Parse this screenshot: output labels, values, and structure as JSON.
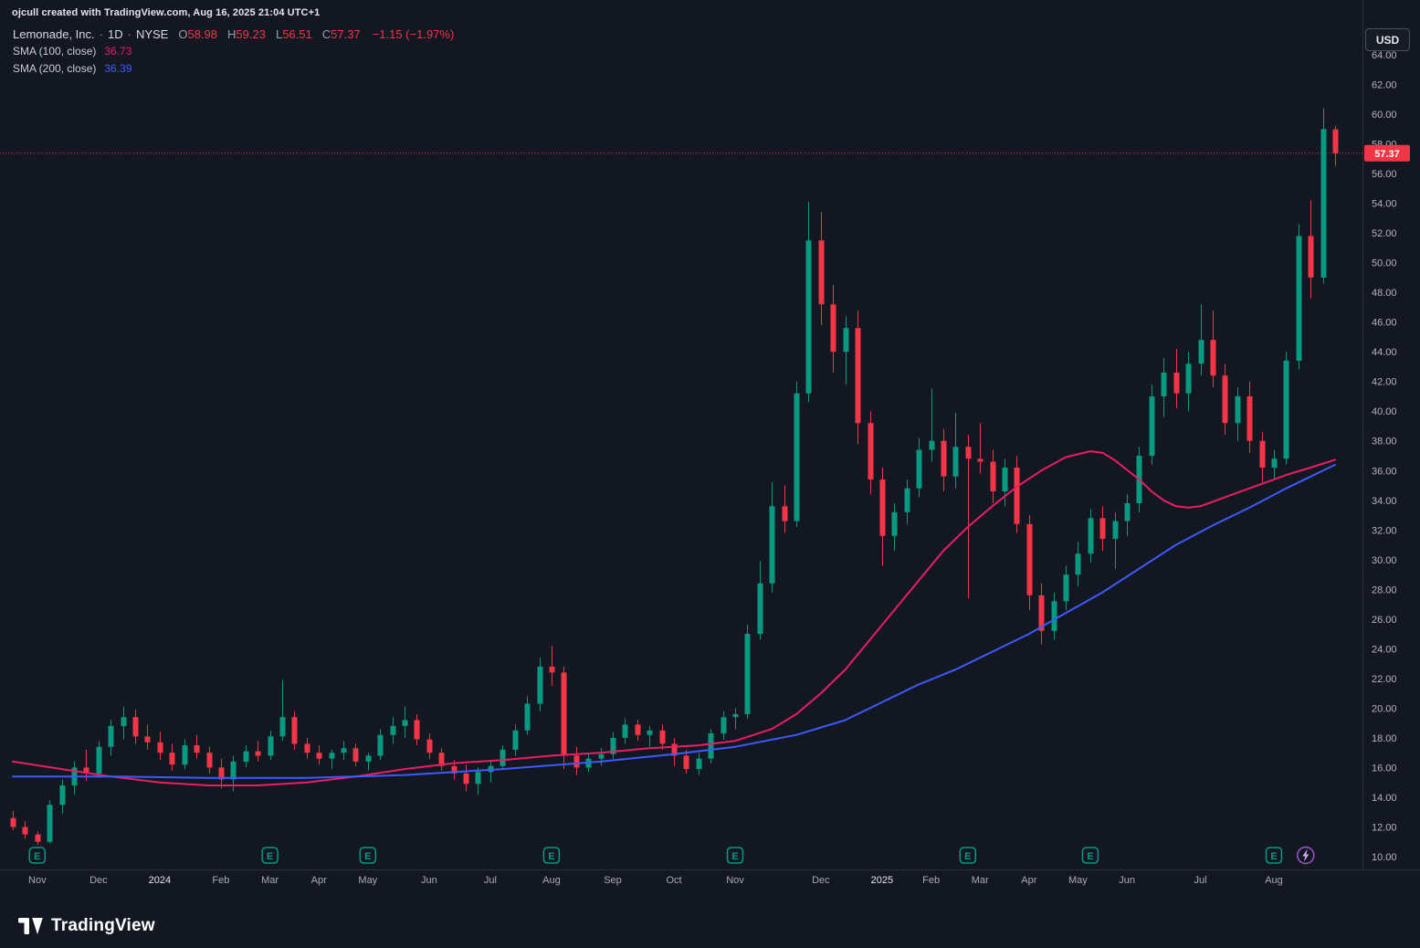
{
  "watermark": "ojcull created with TradingView.com, Aug 16, 2025 21:04 UTC+1",
  "legend": {
    "title": "Lemonade, Inc.",
    "separator": "·",
    "interval": "1D",
    "exchange": "NYSE",
    "open_label": "O",
    "open": "58.98",
    "high_label": "H",
    "high": "59.23",
    "low_label": "L",
    "low": "56.51",
    "close_label": "C",
    "close": "57.37",
    "change": "−1.15 (−1.97%)",
    "indicators": [
      {
        "label": "SMA (100, close)",
        "value": "36.73",
        "color": "#e91e63"
      },
      {
        "label": "SMA (200, close)",
        "value": "36.39",
        "color": "#3d5afe"
      }
    ]
  },
  "axis": {
    "currency_label": "USD",
    "price_labels": [
      "64.00",
      "62.00",
      "60.00",
      "58.00",
      "56.00",
      "54.00",
      "52.00",
      "50.00",
      "48.00",
      "46.00",
      "44.00",
      "42.00",
      "40.00",
      "38.00",
      "36.00",
      "34.00",
      "32.00",
      "30.00",
      "28.00",
      "26.00",
      "24.00",
      "22.00",
      "20.00",
      "18.00",
      "16.00",
      "14.00",
      "12.00",
      "10.00"
    ]
  },
  "footer": {
    "logo_text": "TradingView"
  },
  "chart_data": {
    "type": "candlestick",
    "title": "Lemonade, Inc. · 1D · NYSE",
    "currency": "USD",
    "y_range": [
      10,
      64
    ],
    "y_tick_step": 2,
    "grid": false,
    "last_price": "57.37",
    "last_candle": {
      "open": 58.98,
      "high": 59.23,
      "low": 56.51,
      "close": 57.37,
      "change": "−1.15",
      "change_pct": "−1.97%"
    },
    "colors": {
      "up": "#089981",
      "down": "#f23645",
      "last_price_bg": "#f23645",
      "earnings": "#089981",
      "lightning": "#9b59d0",
      "lightning_bolt": "#d6a6f2"
    },
    "earnings_letter": "E",
    "earnings_marks": [
      2,
      21,
      29,
      44,
      59,
      78,
      88,
      103
    ],
    "lightning_index": 105.6,
    "months": [
      {
        "label": "Nov",
        "i": 2
      },
      {
        "label": "Dec",
        "i": 7
      },
      {
        "label": "2024",
        "i": 12,
        "year": true
      },
      {
        "label": "Feb",
        "i": 17
      },
      {
        "label": "Mar",
        "i": 21
      },
      {
        "label": "Apr",
        "i": 25
      },
      {
        "label": "May",
        "i": 29
      },
      {
        "label": "Jun",
        "i": 34
      },
      {
        "label": "Jul",
        "i": 39
      },
      {
        "label": "Aug",
        "i": 44
      },
      {
        "label": "Sep",
        "i": 49
      },
      {
        "label": "Oct",
        "i": 54
      },
      {
        "label": "Nov",
        "i": 59
      },
      {
        "label": "Dec",
        "i": 66
      },
      {
        "label": "2025",
        "i": 71,
        "year": true
      },
      {
        "label": "Feb",
        "i": 75
      },
      {
        "label": "Mar",
        "i": 79
      },
      {
        "label": "Apr",
        "i": 83
      },
      {
        "label": "May",
        "i": 87
      },
      {
        "label": "Jun",
        "i": 91
      },
      {
        "label": "Jul",
        "i": 97
      },
      {
        "label": "Aug",
        "i": 103
      }
    ],
    "candles": [
      [
        12.6,
        13.1,
        11.8,
        12.0
      ],
      [
        12.0,
        12.4,
        11.2,
        11.5
      ],
      [
        11.5,
        11.7,
        10.8,
        11.0
      ],
      [
        11.0,
        13.8,
        10.9,
        13.5
      ],
      [
        13.5,
        15.2,
        12.9,
        14.8
      ],
      [
        14.8,
        16.4,
        14.2,
        16.0
      ],
      [
        16.0,
        17.2,
        15.1,
        15.6
      ],
      [
        15.6,
        17.8,
        15.3,
        17.4
      ],
      [
        17.4,
        19.2,
        16.8,
        18.8
      ],
      [
        18.8,
        20.1,
        17.9,
        19.4
      ],
      [
        19.4,
        19.9,
        17.6,
        18.1
      ],
      [
        18.1,
        18.9,
        17.2,
        17.7
      ],
      [
        17.7,
        18.4,
        16.5,
        17.0
      ],
      [
        17.0,
        17.6,
        15.8,
        16.2
      ],
      [
        16.2,
        17.9,
        15.9,
        17.5
      ],
      [
        17.5,
        18.2,
        16.6,
        17.0
      ],
      [
        17.0,
        17.4,
        15.6,
        16.0
      ],
      [
        16.0,
        16.6,
        14.6,
        15.2
      ],
      [
        15.2,
        16.8,
        14.4,
        16.4
      ],
      [
        16.4,
        17.5,
        16.0,
        17.1
      ],
      [
        17.1,
        17.8,
        16.4,
        16.8
      ],
      [
        16.8,
        18.5,
        16.5,
        18.1
      ],
      [
        18.1,
        21.9,
        17.8,
        19.4
      ],
      [
        19.4,
        19.8,
        17.2,
        17.6
      ],
      [
        17.6,
        18.0,
        16.6,
        17.0
      ],
      [
        17.0,
        17.5,
        16.2,
        16.6
      ],
      [
        16.6,
        17.2,
        15.9,
        17.0
      ],
      [
        17.0,
        17.8,
        16.5,
        17.3
      ],
      [
        17.3,
        17.6,
        16.1,
        16.4
      ],
      [
        16.4,
        17.0,
        15.8,
        16.8
      ],
      [
        16.8,
        18.6,
        16.5,
        18.2
      ],
      [
        18.2,
        19.4,
        17.6,
        18.8
      ],
      [
        18.8,
        20.1,
        18.0,
        19.2
      ],
      [
        19.2,
        19.6,
        17.5,
        17.9
      ],
      [
        17.9,
        18.3,
        16.6,
        17.0
      ],
      [
        17.0,
        17.3,
        15.8,
        16.1
      ],
      [
        16.1,
        16.5,
        15.2,
        15.6
      ],
      [
        15.6,
        16.2,
        14.4,
        14.9
      ],
      [
        14.9,
        16.0,
        14.2,
        15.7
      ],
      [
        15.7,
        16.4,
        15.0,
        16.1
      ],
      [
        16.1,
        17.5,
        15.9,
        17.2
      ],
      [
        17.2,
        18.9,
        16.8,
        18.5
      ],
      [
        18.5,
        20.8,
        18.2,
        20.3
      ],
      [
        20.3,
        23.4,
        19.8,
        22.8
      ],
      [
        22.8,
        24.2,
        21.5,
        22.4
      ],
      [
        22.4,
        22.8,
        15.9,
        16.8
      ],
      [
        16.8,
        17.4,
        15.5,
        16.0
      ],
      [
        16.0,
        17.0,
        15.7,
        16.6
      ],
      [
        16.6,
        17.3,
        16.1,
        16.9
      ],
      [
        16.9,
        18.4,
        16.6,
        18.0
      ],
      [
        18.0,
        19.3,
        17.6,
        18.9
      ],
      [
        18.9,
        19.2,
        17.8,
        18.2
      ],
      [
        18.2,
        18.8,
        17.4,
        18.5
      ],
      [
        18.5,
        18.9,
        17.2,
        17.6
      ],
      [
        17.6,
        18.0,
        16.1,
        16.8
      ],
      [
        16.8,
        17.2,
        15.6,
        15.9
      ],
      [
        15.9,
        17.0,
        15.5,
        16.6
      ],
      [
        16.6,
        18.6,
        16.3,
        18.3
      ],
      [
        18.3,
        19.8,
        17.9,
        19.4
      ],
      [
        19.4,
        20.0,
        18.6,
        19.6
      ],
      [
        19.6,
        25.6,
        19.3,
        25.0
      ],
      [
        25.0,
        29.9,
        24.6,
        28.4
      ],
      [
        28.4,
        35.2,
        27.8,
        33.6
      ],
      [
        33.6,
        35.0,
        31.8,
        32.6
      ],
      [
        32.6,
        42.0,
        32.2,
        41.2
      ],
      [
        41.2,
        54.1,
        40.6,
        51.5
      ],
      [
        51.5,
        53.4,
        45.8,
        47.2
      ],
      [
        47.2,
        48.5,
        42.6,
        44.0
      ],
      [
        44.0,
        46.4,
        41.8,
        45.6
      ],
      [
        45.6,
        46.8,
        37.8,
        39.2
      ],
      [
        39.2,
        40.0,
        34.4,
        35.4
      ],
      [
        35.4,
        36.2,
        29.6,
        31.6
      ],
      [
        31.6,
        33.8,
        30.6,
        33.2
      ],
      [
        33.2,
        35.4,
        32.4,
        34.8
      ],
      [
        34.8,
        38.2,
        34.2,
        37.4
      ],
      [
        37.4,
        41.5,
        36.6,
        38.0
      ],
      [
        38.0,
        38.8,
        34.6,
        35.6
      ],
      [
        35.6,
        39.9,
        34.8,
        37.6
      ],
      [
        37.6,
        38.4,
        27.4,
        36.8
      ],
      [
        36.8,
        39.2,
        35.8,
        36.6
      ],
      [
        36.6,
        37.4,
        33.8,
        34.6
      ],
      [
        34.6,
        36.8,
        33.6,
        36.2
      ],
      [
        36.2,
        37.0,
        31.8,
        32.4
      ],
      [
        32.4,
        33.0,
        26.6,
        27.6
      ],
      [
        27.6,
        28.4,
        24.3,
        25.2
      ],
      [
        25.2,
        27.8,
        24.6,
        27.2
      ],
      [
        27.2,
        29.6,
        26.6,
        29.0
      ],
      [
        29.0,
        31.2,
        28.2,
        30.4
      ],
      [
        30.4,
        33.4,
        29.8,
        32.8
      ],
      [
        32.8,
        33.6,
        30.6,
        31.4
      ],
      [
        31.4,
        33.2,
        29.4,
        32.6
      ],
      [
        32.6,
        34.4,
        31.6,
        33.8
      ],
      [
        33.8,
        37.6,
        33.2,
        37.0
      ],
      [
        37.0,
        41.8,
        36.4,
        41.0
      ],
      [
        41.0,
        43.6,
        39.6,
        42.6
      ],
      [
        42.6,
        44.2,
        40.2,
        41.2
      ],
      [
        41.2,
        44.0,
        40.0,
        43.2
      ],
      [
        43.2,
        47.2,
        42.4,
        44.8
      ],
      [
        44.8,
        46.8,
        41.6,
        42.4
      ],
      [
        42.4,
        43.2,
        38.4,
        39.2
      ],
      [
        39.2,
        41.6,
        38.0,
        41.0
      ],
      [
        41.0,
        42.0,
        37.2,
        38.0
      ],
      [
        38.0,
        38.6,
        35.2,
        36.2
      ],
      [
        36.2,
        37.4,
        35.4,
        36.8
      ],
      [
        36.8,
        44.0,
        36.4,
        43.4
      ],
      [
        43.4,
        52.6,
        42.8,
        51.8
      ],
      [
        51.8,
        54.2,
        47.6,
        49.0
      ],
      [
        49.0,
        60.4,
        48.6,
        59.0
      ],
      [
        58.98,
        59.23,
        56.51,
        57.37
      ]
    ],
    "overlays": [
      {
        "name": "SMA (100, close)",
        "period": 100,
        "value": 36.73,
        "color": "#e91e63",
        "points": [
          [
            0,
            16.4
          ],
          [
            4,
            15.9
          ],
          [
            8,
            15.4
          ],
          [
            12,
            15.0
          ],
          [
            16,
            14.8
          ],
          [
            20,
            14.8
          ],
          [
            24,
            15.0
          ],
          [
            28,
            15.4
          ],
          [
            32,
            15.9
          ],
          [
            36,
            16.3
          ],
          [
            40,
            16.5
          ],
          [
            44,
            16.8
          ],
          [
            48,
            17.0
          ],
          [
            52,
            17.3
          ],
          [
            56,
            17.5
          ],
          [
            59,
            17.8
          ],
          [
            62,
            18.6
          ],
          [
            64,
            19.6
          ],
          [
            66,
            21.0
          ],
          [
            68,
            22.6
          ],
          [
            70,
            24.6
          ],
          [
            72,
            26.6
          ],
          [
            74,
            28.6
          ],
          [
            76,
            30.6
          ],
          [
            78,
            32.2
          ],
          [
            80,
            33.6
          ],
          [
            82,
            34.9
          ],
          [
            84,
            36.0
          ],
          [
            86,
            36.9
          ],
          [
            88,
            37.3
          ],
          [
            89,
            37.2
          ],
          [
            90,
            36.7
          ],
          [
            92,
            35.4
          ],
          [
            93,
            34.6
          ],
          [
            94,
            34.0
          ],
          [
            95,
            33.6
          ],
          [
            96,
            33.5
          ],
          [
            97,
            33.6
          ],
          [
            98,
            33.9
          ],
          [
            100,
            34.5
          ],
          [
            102,
            35.1
          ],
          [
            104,
            35.7
          ],
          [
            106,
            36.2
          ],
          [
            108,
            36.73
          ]
        ]
      },
      {
        "name": "SMA (200, close)",
        "period": 200,
        "value": 36.39,
        "color": "#3d5afe",
        "points": [
          [
            0,
            15.4
          ],
          [
            8,
            15.4
          ],
          [
            16,
            15.3
          ],
          [
            24,
            15.3
          ],
          [
            32,
            15.5
          ],
          [
            40,
            15.9
          ],
          [
            48,
            16.4
          ],
          [
            54,
            16.9
          ],
          [
            59,
            17.4
          ],
          [
            64,
            18.2
          ],
          [
            68,
            19.2
          ],
          [
            71,
            20.4
          ],
          [
            74,
            21.6
          ],
          [
            77,
            22.6
          ],
          [
            80,
            23.8
          ],
          [
            83,
            25.0
          ],
          [
            86,
            26.4
          ],
          [
            89,
            27.8
          ],
          [
            92,
            29.4
          ],
          [
            95,
            31.0
          ],
          [
            98,
            32.3
          ],
          [
            101,
            33.5
          ],
          [
            104,
            34.8
          ],
          [
            106,
            35.6
          ],
          [
            108,
            36.39
          ]
        ]
      }
    ]
  }
}
